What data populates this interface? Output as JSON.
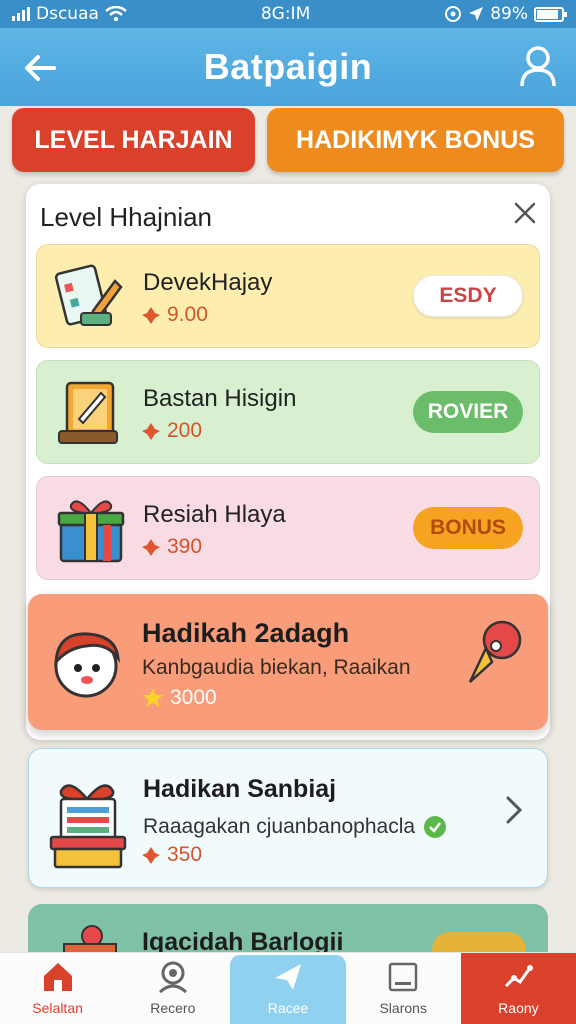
{
  "status_bar": {
    "carrier": "Dscuaa",
    "time": "8G:IM",
    "battery": "89%",
    "battery_level": 0.89
  },
  "header": {
    "title": "Batpaigin",
    "back_icon": "arrow-left-icon",
    "user_icon": "user-icon"
  },
  "tabs": [
    {
      "label": "LEVEL HARJAIN",
      "color": "#d9412b"
    },
    {
      "label": "HADIKIMYK BONUS",
      "color": "#ee8b1f"
    }
  ],
  "panel": {
    "title": "Level Hhajnian",
    "items": [
      {
        "name": "DevekHajay",
        "price": "9.00",
        "button": "ESDY",
        "icon": "tasks-icon"
      },
      {
        "name": "Bastan Hisigin",
        "price": "200",
        "button": "ROVIER",
        "icon": "notebook-icon"
      },
      {
        "name": "Resiah Hlaya",
        "price": "390",
        "button": "BONUS",
        "icon": "gift-icon"
      }
    ]
  },
  "cards": [
    {
      "title": "Hadikah 2adagh",
      "subtitle": "Kanbgaudia biekan, Raaikan",
      "price": "3000",
      "icon": "mascot-icon"
    },
    {
      "title": "Hadikan Sanbiaj",
      "subtitle": "Raaagakan cjuanbanophacla",
      "price": "350",
      "icon": "gift-box-icon"
    },
    {
      "title": "Iqacidah Barlogii",
      "icon": "gift-icon"
    }
  ],
  "nav": [
    {
      "label": "Selaltan",
      "icon": "home-icon"
    },
    {
      "label": "Recero",
      "icon": "profile-icon"
    },
    {
      "label": "Racee",
      "icon": "send-icon"
    },
    {
      "label": "Slarons",
      "icon": "card-icon"
    },
    {
      "label": "Raony",
      "icon": "chart-icon"
    }
  ],
  "colors": {
    "header": "#4aa3db",
    "accent_red": "#d9412b",
    "accent_orange": "#ee8b1f",
    "highlight_card": "#f89c79"
  }
}
